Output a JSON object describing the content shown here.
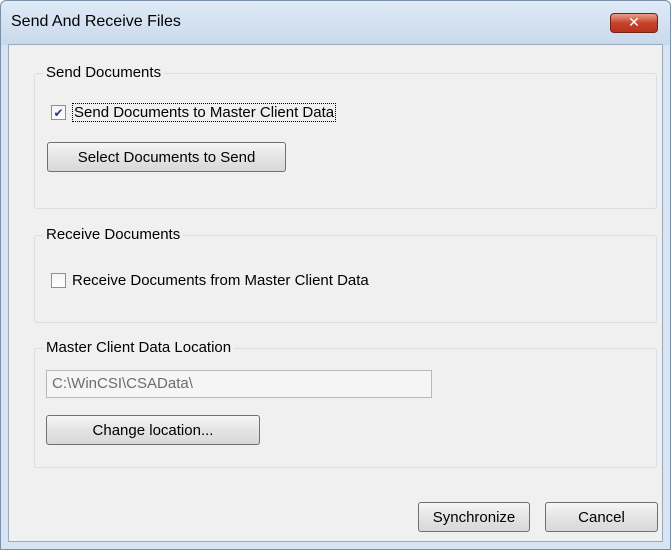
{
  "window": {
    "title": "Send And Receive Files",
    "close_glyph": "✕"
  },
  "send_group": {
    "legend": "Send Documents",
    "checkbox_label": "Send Documents to Master Client Data",
    "checkbox_checked": true,
    "select_button_label": "Select Documents to Send"
  },
  "receive_group": {
    "legend": "Receive Documents",
    "checkbox_label": "Receive Documents from Master Client Data",
    "checkbox_checked": false
  },
  "location_group": {
    "legend": "Master Client Data Location",
    "path_value": "C:\\WinCSI\\CSAData\\",
    "change_button_label": "Change location..."
  },
  "footer": {
    "synchronize_label": "Synchronize",
    "cancel_label": "Cancel"
  }
}
